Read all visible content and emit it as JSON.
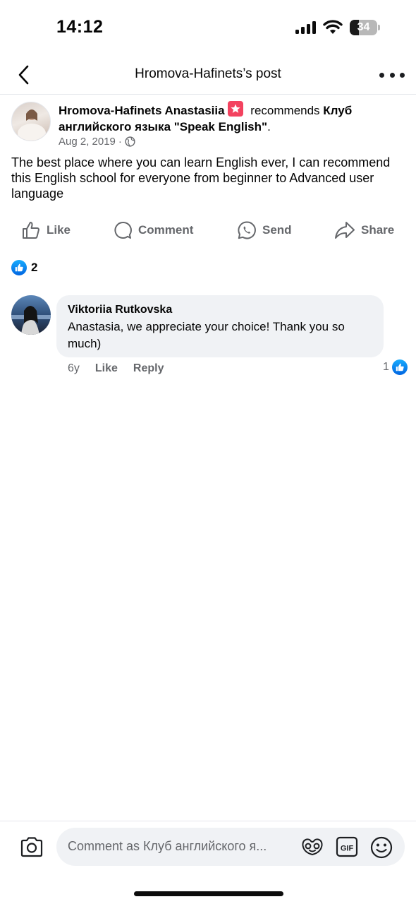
{
  "status_bar": {
    "time": "14:12",
    "battery_level": "34",
    "battery_fraction": 0.34
  },
  "header": {
    "title": "Hromova-Hafinets’s post",
    "back_icon": "chevron-left-icon",
    "more_icon": "more-horizontal-icon"
  },
  "post": {
    "author": "Hromova-Hafinets Anastasiia",
    "badge_icon": "star-badge-icon",
    "recommends_label": "recommends",
    "page_name": "Клуб английского языка \"Speak English\"",
    "period": ".",
    "date": "Aug 2, 2019",
    "separator": "·",
    "privacy_icon": "globe-icon",
    "body": "The best place where you can learn English ever, I can recommend this English school for everyone from beginner to Advanced user language"
  },
  "actions": {
    "like": "Like",
    "comment": "Comment",
    "send": "Send",
    "share": "Share"
  },
  "reactions": {
    "icon": "like-reaction-icon",
    "count": "2"
  },
  "comments": [
    {
      "author": "Viktoriia Rutkovska",
      "text": "Anastasia, we appreciate your choice! Thank you so much)",
      "age": "6y",
      "like_label": "Like",
      "reply_label": "Reply",
      "reaction_count": "1"
    }
  ],
  "composer": {
    "placeholder": "Comment as Клуб английского я...",
    "camera_icon": "camera-icon",
    "sticker_icon": "sticker-icon",
    "gif_label": "GIF",
    "emoji_icon": "emoji-icon"
  },
  "colors": {
    "primary_text": "#050505",
    "secondary_text": "#65676b",
    "facebook_blue": "#0866ff",
    "bubble_bg": "#f0f2f5",
    "badge_red": "#f3425f"
  }
}
